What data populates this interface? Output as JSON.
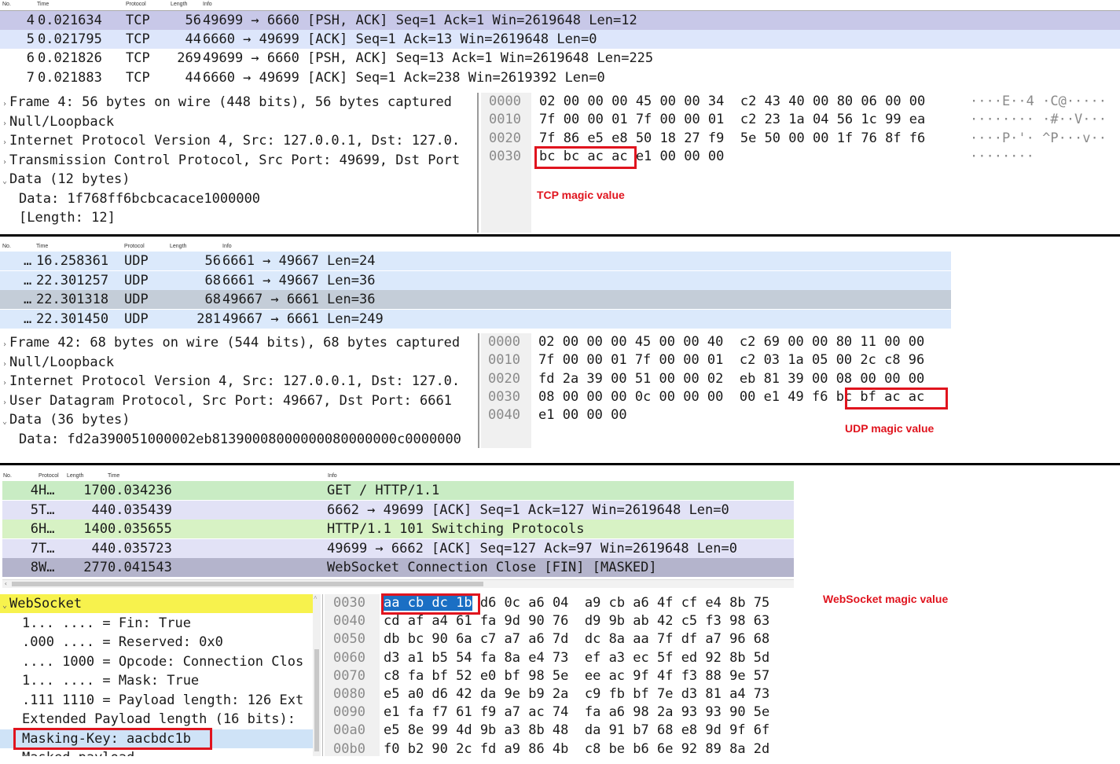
{
  "tcp": {
    "columns": [
      "No.",
      "Time",
      "Protocol",
      "Length",
      "Info"
    ],
    "packets": [
      {
        "no": "4",
        "time": "0.021634",
        "proto": "TCP",
        "len": "56",
        "info": "49699 → 6660 [PSH, ACK] Seq=1 Ack=1 Win=2619648 Len=12",
        "bg": "#c8c8e8"
      },
      {
        "no": "5",
        "time": "0.021795",
        "proto": "TCP",
        "len": "44",
        "info": "6660 → 49699 [ACK] Seq=1 Ack=13 Win=2619648 Len=0",
        "bg": "#dde6fb"
      },
      {
        "no": "6",
        "time": "0.021826",
        "proto": "TCP",
        "len": "269",
        "info": "49699 → 6660 [PSH, ACK] Seq=13 Ack=1 Win=2619648 Len=225",
        "bg": "#ffffff"
      },
      {
        "no": "7",
        "time": "0.021883",
        "proto": "TCP",
        "len": "44",
        "info": "6660 → 49699 [ACK] Seq=1 Ack=238 Win=2619392 Len=0",
        "bg": "#ffffff"
      }
    ],
    "details": [
      {
        "text": "Frame 4: 56 bytes on wire (448 bits), 56 bytes captured",
        "arrow": "›",
        "indent": 0
      },
      {
        "text": "Null/Loopback",
        "arrow": "›",
        "indent": 0
      },
      {
        "text": "Internet Protocol Version 4, Src: 127.0.0.1, Dst: 127.0.",
        "arrow": "›",
        "indent": 0
      },
      {
        "text": "Transmission Control Protocol, Src Port: 49699, Dst Port",
        "arrow": "›",
        "indent": 0
      },
      {
        "text": "Data (12 bytes)",
        "arrow": "⌄",
        "indent": 0
      },
      {
        "text": "Data: 1f768ff6bcbcacace1000000",
        "arrow": "",
        "indent": 1
      },
      {
        "text": "[Length: 12]",
        "arrow": "",
        "indent": 1
      }
    ],
    "hex": [
      {
        "offset": "0000",
        "bytes": "02 00 00 00 45 00 00 34  c2 43 40 00 80 06 00 00",
        "ascii": "····E··4 ·C@·····"
      },
      {
        "offset": "0010",
        "bytes": "7f 00 00 01 7f 00 00 01  c2 23 1a 04 56 1c 99 ea",
        "ascii": "········ ·#··V···"
      },
      {
        "offset": "0020",
        "bytes": "7f 86 e5 e8 50 18 27 f9  5e 50 00 00 1f 76 8f f6",
        "ascii": "····P·'· ^P···v··"
      },
      {
        "offset": "0030",
        "bytes": "bc bc ac ac e1 00 00 00",
        "ascii": "········"
      }
    ],
    "annotation": "TCP magic value"
  },
  "udp": {
    "columns": [
      "No.",
      "Time",
      "Protocol",
      "Length",
      "Info"
    ],
    "packets": [
      {
        "no": "…",
        "time": "16.258361",
        "proto": "UDP",
        "len": "56",
        "info": "6661 → 49667 Len=24",
        "bg": "#dbe9fb"
      },
      {
        "no": "…",
        "time": "22.301257",
        "proto": "UDP",
        "len": "68",
        "info": "6661 → 49667 Len=36",
        "bg": "#dbe9fb"
      },
      {
        "no": "…",
        "time": "22.301318",
        "proto": "UDP",
        "len": "68",
        "info": "49667 → 6661 Len=36",
        "bg": "#c4cdd8"
      },
      {
        "no": "…",
        "time": "22.301450",
        "proto": "UDP",
        "len": "281",
        "info": "49667 → 6661 Len=249",
        "bg": "#dbe9fb"
      }
    ],
    "details": [
      {
        "text": "Frame 42: 68 bytes on wire (544 bits), 68 bytes captured",
        "arrow": "›",
        "indent": 0
      },
      {
        "text": "Null/Loopback",
        "arrow": "›",
        "indent": 0
      },
      {
        "text": "Internet Protocol Version 4, Src: 127.0.0.1, Dst: 127.0.",
        "arrow": "›",
        "indent": 0
      },
      {
        "text": "User Datagram Protocol, Src Port: 49667, Dst Port: 6661",
        "arrow": "›",
        "indent": 0
      },
      {
        "text": "Data (36 bytes)",
        "arrow": "⌄",
        "indent": 0
      },
      {
        "text": "Data: fd2a390051000002eb81390008000000080000000c0000000",
        "arrow": "",
        "indent": 1
      }
    ],
    "hex": [
      {
        "offset": "0000",
        "bytes": "02 00 00 00 45 00 00 40  c2 69 00 00 80 11 00 00"
      },
      {
        "offset": "0010",
        "bytes": "7f 00 00 01 7f 00 00 01  c2 03 1a 05 00 2c c8 96"
      },
      {
        "offset": "0020",
        "bytes": "fd 2a 39 00 51 00 00 02  eb 81 39 00 08 00 00 00"
      },
      {
        "offset": "0030",
        "bytes": "08 00 00 00 0c 00 00 00  00 e1 49 f6 bc bf ac ac"
      },
      {
        "offset": "0040",
        "bytes": "e1 00 00 00"
      }
    ],
    "annotation": "UDP magic value"
  },
  "ws": {
    "columns": [
      "No.",
      "Protocol",
      "Length",
      "Time",
      "Info"
    ],
    "packets": [
      {
        "no": "4",
        "proto": "H…",
        "len": "170",
        "time": "0.034236",
        "info": "GET / HTTP/1.1",
        "bg": "#c9ecc4"
      },
      {
        "no": "5",
        "proto": "T…",
        "len": "44",
        "time": "0.035439",
        "info": "6662 → 49699 [ACK] Seq=1 Ack=127 Win=2619648 Len=0",
        "bg": "#e2e2f6"
      },
      {
        "no": "6",
        "proto": "H…",
        "len": "140",
        "time": "0.035655",
        "info": "HTTP/1.1 101 Switching Protocols",
        "bg": "#d7f2c4"
      },
      {
        "no": "7",
        "proto": "T…",
        "len": "44",
        "time": "0.035723",
        "info": "49699 → 6662 [ACK] Seq=127 Ack=97 Win=2619648 Len=0",
        "bg": "#e2e2f6"
      },
      {
        "no": "8",
        "proto": "W…",
        "len": "277",
        "time": "0.041543",
        "info": "WebSocket Connection Close [FIN] [MASKED]",
        "bg": "#b4b4cc"
      }
    ],
    "details": [
      {
        "text": "WebSocket",
        "arrow": "⌄",
        "indent": 0,
        "bg": "#f7f24d"
      },
      {
        "text": "1... .... = Fin: True",
        "arrow": "",
        "indent": 1
      },
      {
        "text": ".000 .... = Reserved: 0x0",
        "arrow": "",
        "indent": 1
      },
      {
        "text": ".... 1000 = Opcode: Connection Clos",
        "arrow": "",
        "indent": 1
      },
      {
        "text": "1... .... = Mask: True",
        "arrow": "",
        "indent": 1
      },
      {
        "text": ".111 1110 = Payload length: 126 Ext",
        "arrow": "",
        "indent": 1
      },
      {
        "text": "Extended Payload length (16 bits):",
        "arrow": "",
        "indent": 1
      },
      {
        "text": "Masking-Key: aacbdc1b",
        "arrow": "",
        "indent": 1,
        "bg": "#cfe3f7"
      },
      {
        "text": "Masked payload",
        "arrow": "",
        "indent": 1
      }
    ],
    "hex": [
      {
        "offset": "0030",
        "sel": "aa cb dc 1b",
        "bytes": " d6 0c a6 04  a9 cb a6 4f cf e4 8b 75"
      },
      {
        "offset": "0040",
        "sel": "",
        "bytes": "cd af a4 61 fa 9d 90 76  d9 9b ab 42 c5 f3 98 63"
      },
      {
        "offset": "0050",
        "sel": "",
        "bytes": "db bc 90 6a c7 a7 a6 7d  dc 8a aa 7f df a7 96 68"
      },
      {
        "offset": "0060",
        "sel": "",
        "bytes": "d3 a1 b5 54 fa 8a e4 73  ef a3 ec 5f ed 92 8b 5d"
      },
      {
        "offset": "0070",
        "sel": "",
        "bytes": "c8 fa bf 52 e0 bf 98 5e  ee ac 9f 4f f3 88 9e 57"
      },
      {
        "offset": "0080",
        "sel": "",
        "bytes": "e5 a0 d6 42 da 9e b9 2a  c9 fb bf 7e d3 81 a4 73"
      },
      {
        "offset": "0090",
        "sel": "",
        "bytes": "e1 fa f7 61 f9 a7 ac 74  fa a6 98 2a 93 93 90 5e"
      },
      {
        "offset": "00a0",
        "sel": "",
        "bytes": "e5 8e 99 4d 9b a3 8b 48  da 91 b7 68 e8 9d 9f 6f"
      },
      {
        "offset": "00b0",
        "sel": "",
        "bytes": "f0 b2 90 2c fd a9 86 4b  c8 be b6 6e 92 89 8a 2d"
      }
    ],
    "annotation": "WebSocket magic value"
  }
}
